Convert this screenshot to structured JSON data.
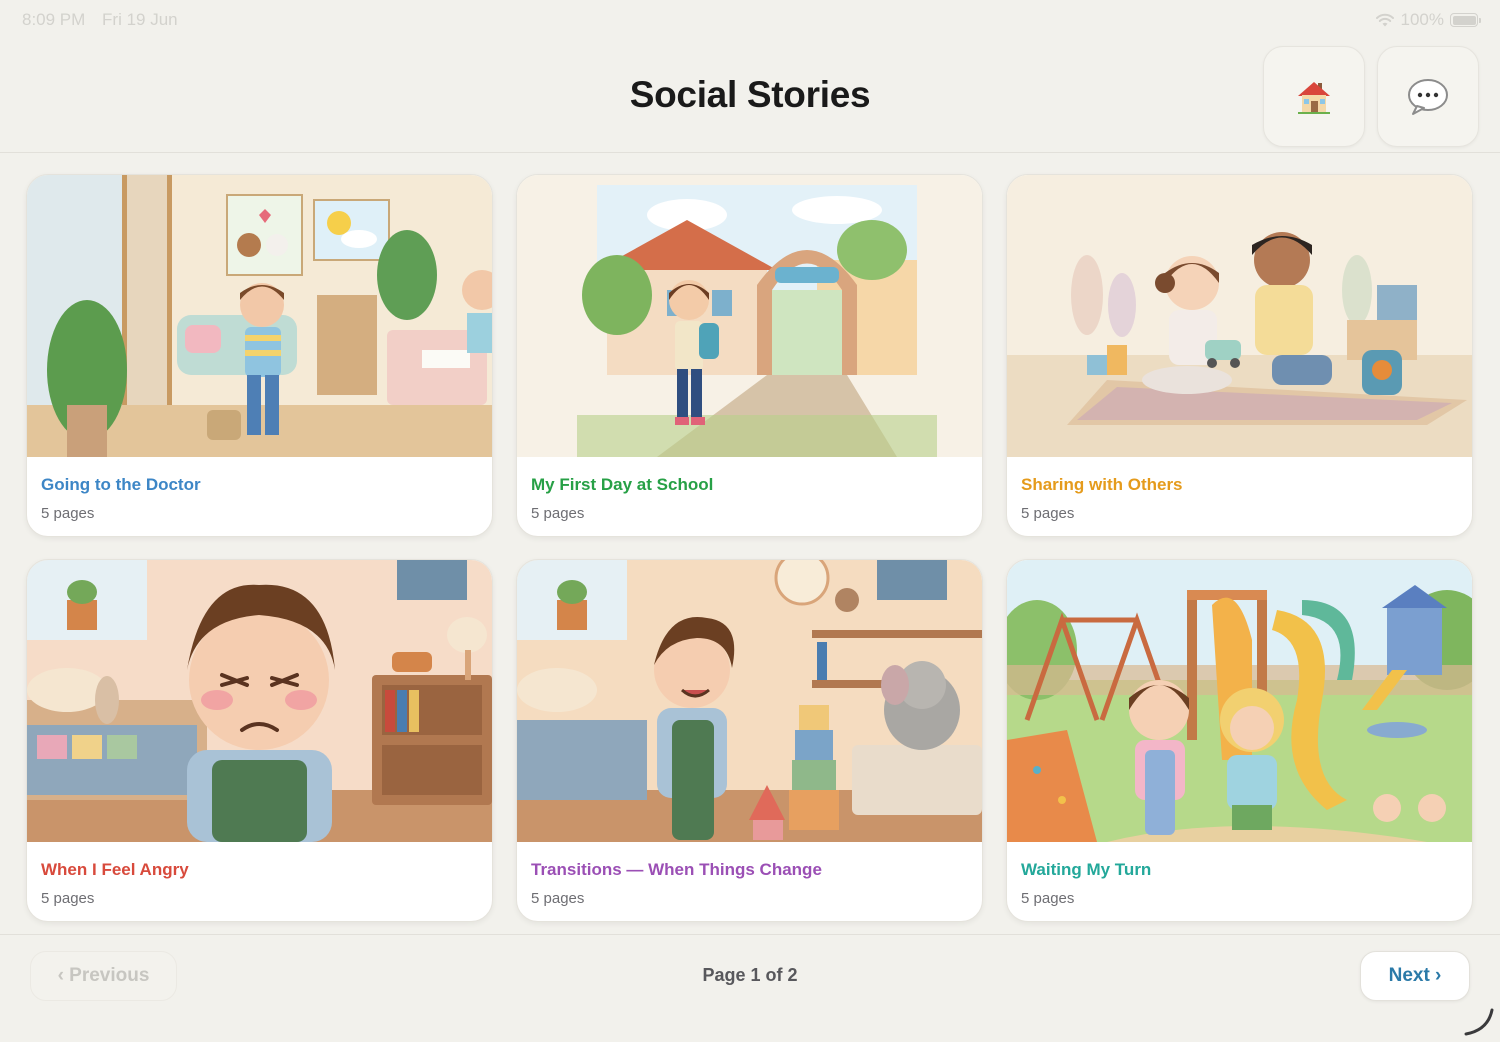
{
  "status_bar": {
    "time": "8:09 PM",
    "date": "Fri 19 Jun",
    "battery_percent": "100%",
    "battery_level": 1.0
  },
  "header": {
    "title": "Social Stories",
    "home_icon": "house-emoji",
    "chat_icon": "speech-bubble-emoji"
  },
  "stories": [
    {
      "title": "Going to the Doctor",
      "pages": "5 pages",
      "color": "#3d86c6",
      "illustration": "doctor-waiting-room"
    },
    {
      "title": "My First Day at School",
      "pages": "5 pages",
      "color": "#27a046",
      "illustration": "school-gate"
    },
    {
      "title": "Sharing with Others",
      "pages": "5 pages",
      "color": "#e59b1c",
      "illustration": "children-sharing-toy"
    },
    {
      "title": "When I Feel Angry",
      "pages": "5 pages",
      "color": "#d84a3c",
      "illustration": "angry-child-bedroom"
    },
    {
      "title": "Transitions — When Things Change",
      "pages": "5 pages",
      "color": "#9b4fb5",
      "illustration": "child-building-blocks"
    },
    {
      "title": "Waiting My Turn",
      "pages": "5 pages",
      "color": "#23a89a",
      "illustration": "playground"
    }
  ],
  "pagination": {
    "previous_label": "‹ Previous",
    "next_label": "Next ›",
    "indicator": "Page 1 of 2",
    "current_page": 1,
    "total_pages": 2
  }
}
